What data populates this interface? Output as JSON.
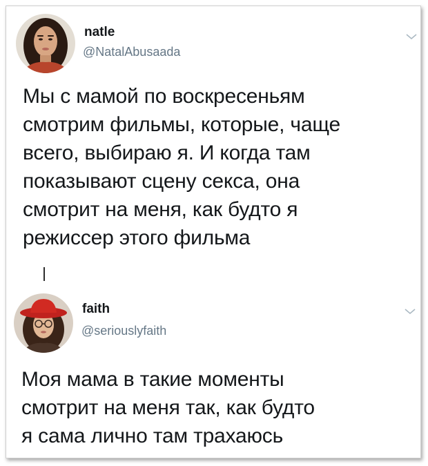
{
  "tweets": [
    {
      "name": "natle",
      "handle": "@NatalAbusaada",
      "text": "Мы с мамой по воскресеньям\nсмотрим фильмы, которые, чаще\nвсего, выбираю я. И когда там\nпоказывают сцену секса, она\nсмотрит на меня, как будто я\nрежиссер этого фильма"
    },
    {
      "name": "faith",
      "handle": "@seriouslyfaith",
      "text": "Моя мама в такие моменты\nсмотрит на меня так, как будто\nя сама лично там трахаюсь"
    }
  ],
  "icons": {
    "more": "chevron-down-icon"
  },
  "colors": {
    "name": "#14171a",
    "handle": "#657786",
    "text": "#14171a",
    "chevron": "#aab8c2"
  }
}
